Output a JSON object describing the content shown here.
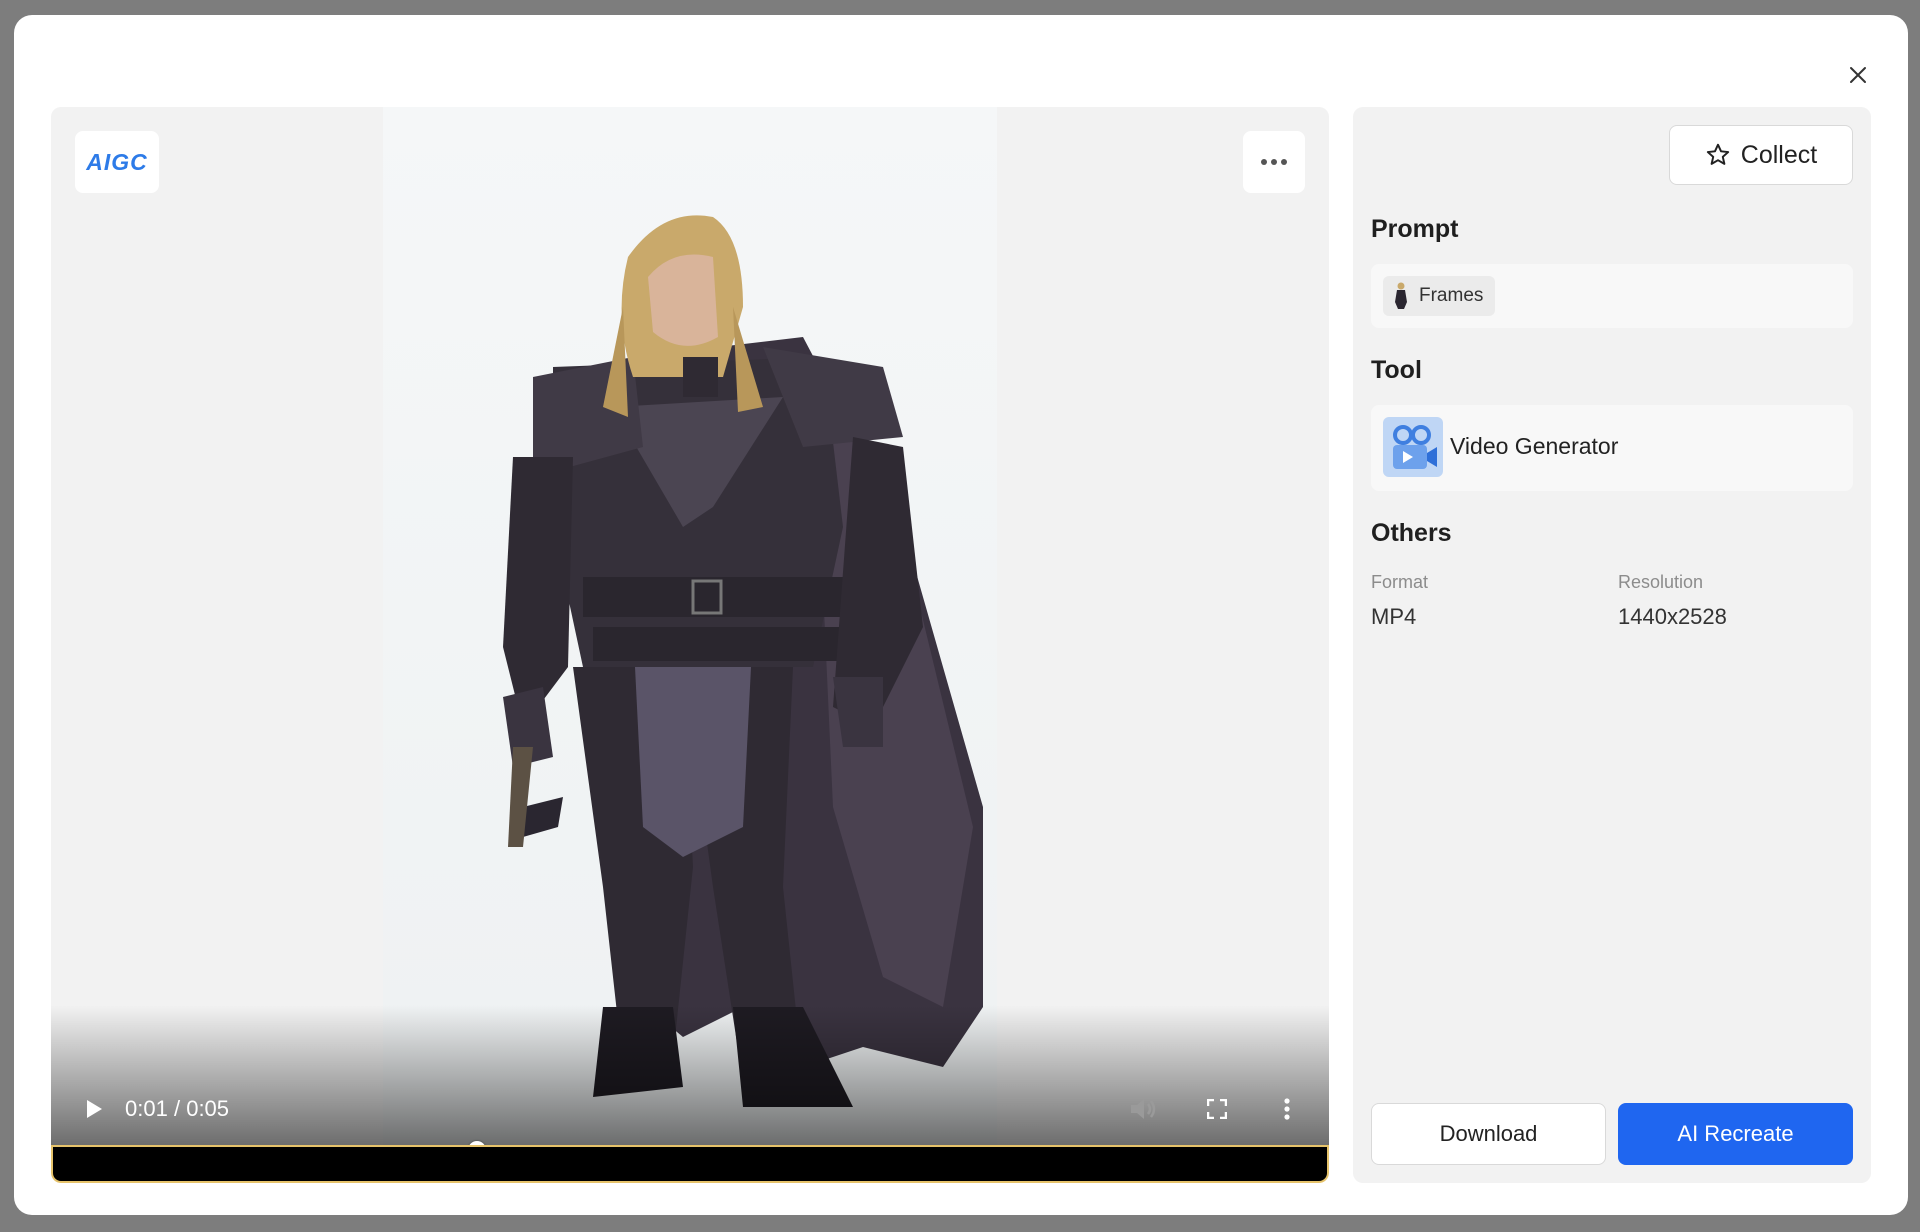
{
  "dialog": {
    "close_label": "×"
  },
  "player": {
    "badge_text": "AIGC",
    "current_time": "0:01",
    "duration": "0:05",
    "separator": "/",
    "progress_fraction": 0.327
  },
  "side": {
    "collect_label": "Collect",
    "prompt_title": "Prompt",
    "prompt_chip_label": "Frames",
    "tool_title": "Tool",
    "tool_name": "Video Generator",
    "others_title": "Others",
    "format_label": "Format",
    "format_value": "MP4",
    "resolution_label": "Resolution",
    "resolution_value": "1440x2528",
    "download_label": "Download",
    "recreate_label": "AI Recreate"
  },
  "colors": {
    "accent": "#1f66f0",
    "badge_text": "#2d7be8",
    "panel_bg": "#f2f2f2"
  },
  "icons": [
    "close-icon",
    "more-icon",
    "play-icon",
    "volume-icon",
    "fullscreen-icon",
    "kebab-menu-icon",
    "star-icon",
    "video-generator-icon",
    "character-thumbnail"
  ]
}
